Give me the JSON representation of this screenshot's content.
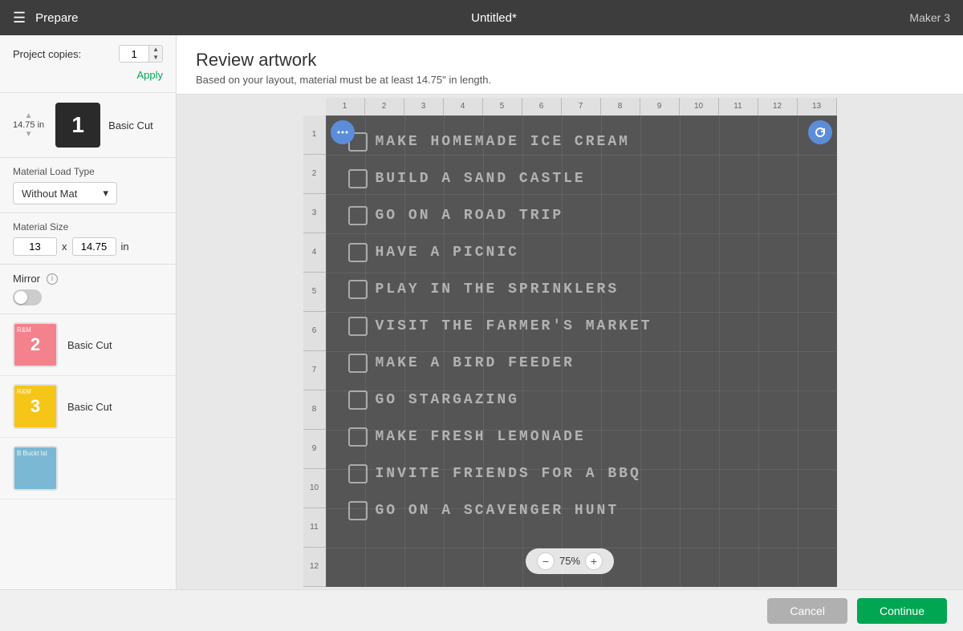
{
  "header": {
    "menu_label": "☰",
    "prepare_label": "Prepare",
    "title": "Untitled*",
    "device": "Maker 3"
  },
  "sidebar": {
    "project_copies_label": "Project copies:",
    "copies_value": "1",
    "apply_label": "Apply",
    "mat1": {
      "size": "14.75 in",
      "number": "1",
      "cut_label": "Basic Cut"
    },
    "material_load_label": "Material Load Type",
    "material_load_value": "Without Mat",
    "material_size_label": "Material Size",
    "material_size_width": "13",
    "material_size_x": "x",
    "material_size_height": "14.75",
    "material_size_unit": "in",
    "mirror_label": "Mirror",
    "mat2": {
      "number": "2",
      "cut_label": "Basic Cut",
      "corner": "R&M"
    },
    "mat3": {
      "number": "3",
      "cut_label": "Basic Cut",
      "corner": "R&M"
    },
    "mat4": {
      "corner": "B Buckt lst"
    }
  },
  "content": {
    "review_title": "Review artwork",
    "review_subtitle": "Based on your layout, material must be at least 14.75\" in length."
  },
  "ruler_top": [
    "1",
    "2",
    "3",
    "4",
    "5",
    "6",
    "7",
    "8",
    "9",
    "10",
    "11",
    "12",
    "13"
  ],
  "ruler_left": [
    "1",
    "2",
    "3",
    "4",
    "5",
    "6",
    "7",
    "8",
    "9",
    "10",
    "11",
    "12"
  ],
  "checklist": [
    "Make Homemade Ice Cream",
    "Build a Sand Castle",
    "Go on a Road Trip",
    "Have a Picnic",
    "Play in the Sprinklers",
    "Visit the Farmer's Market",
    "Make a Bird Feeder",
    "Go Stargazing",
    "Make Fresh Lemonade",
    "Invite Friends for a BBQ",
    "Go on a Scavenger Hunt",
    "Go on a Scavenger Hunt"
  ],
  "zoom": {
    "level": "75%",
    "minus": "−",
    "plus": "+"
  },
  "footer": {
    "cancel_label": "Cancel",
    "continue_label": "Continue"
  }
}
